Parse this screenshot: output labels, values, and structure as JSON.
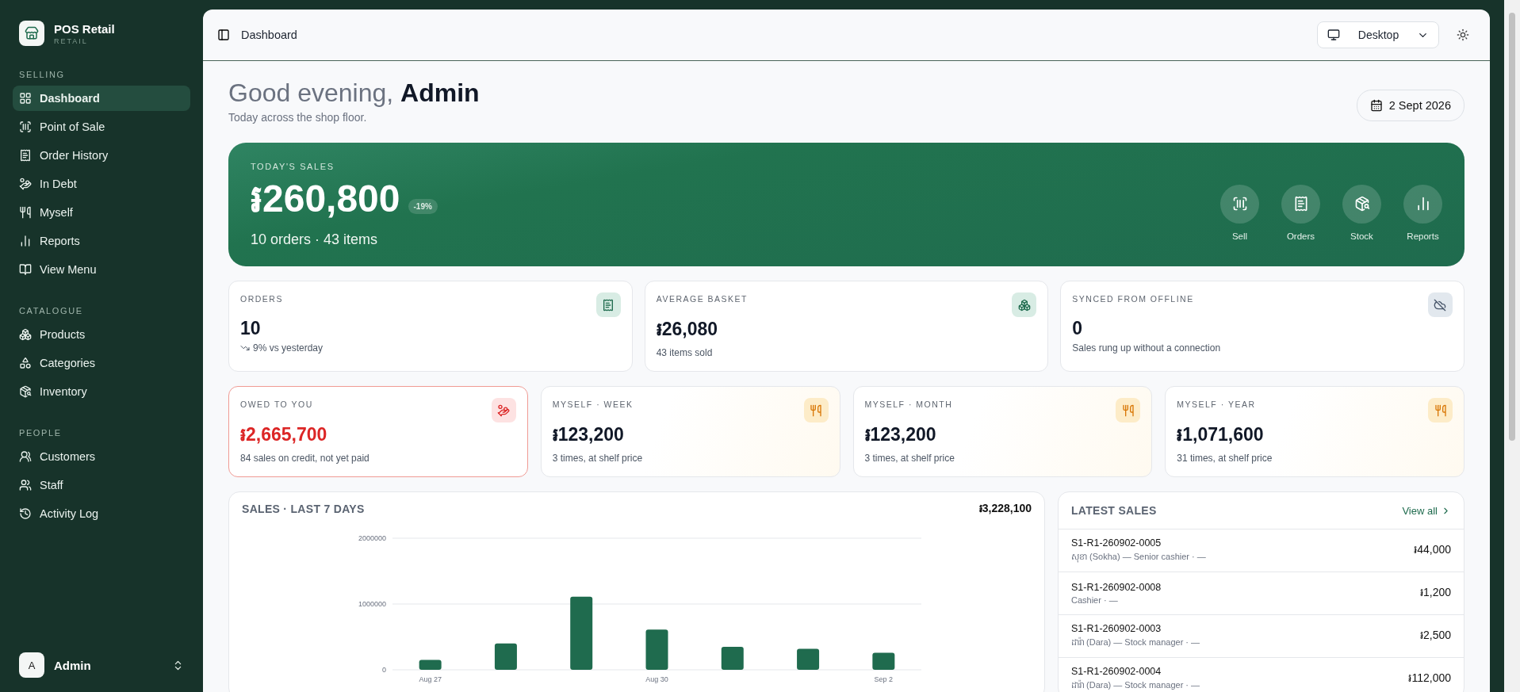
{
  "sidebar": {
    "brand": {
      "name": "POS Retail",
      "tagline": "RETAIL"
    },
    "sections": [
      {
        "title": "SELLING",
        "items": [
          {
            "label": "Dashboard",
            "selected": true
          },
          {
            "label": "Point of Sale",
            "selected": false
          },
          {
            "label": "Order History",
            "selected": false
          },
          {
            "label": "In Debt",
            "selected": false
          },
          {
            "label": "Myself",
            "selected": false
          },
          {
            "label": "Reports",
            "selected": false
          },
          {
            "label": "View Menu",
            "selected": false
          }
        ]
      },
      {
        "title": "CATALOGUE",
        "items": [
          {
            "label": "Products",
            "selected": false
          },
          {
            "label": "Categories",
            "selected": false
          },
          {
            "label": "Inventory",
            "selected": false
          }
        ]
      },
      {
        "title": "PEOPLE",
        "items": [
          {
            "label": "Customers",
            "selected": false
          },
          {
            "label": "Staff",
            "selected": false
          },
          {
            "label": "Activity Log",
            "selected": false
          }
        ]
      }
    ],
    "user": {
      "initial": "A",
      "name": "Admin"
    }
  },
  "header": {
    "breadcrumb": "Dashboard",
    "device": "Desktop"
  },
  "greeting": {
    "title": "Good evening, **Admin**",
    "subtitle": "Today across the shop floor.",
    "date": "2 Sept 2026"
  },
  "hero": {
    "label": "TODAY'S SALES",
    "amount": "៛260,800",
    "change": "-19%",
    "summary": "10 orders · 43 items",
    "actions": [
      "Sell",
      "Orders",
      "Stock",
      "Reports"
    ]
  },
  "stats": [
    {
      "kind": "orders",
      "label": "ORDERS",
      "value": "10",
      "note": "9% vs yesterday"
    },
    {
      "kind": "basket",
      "label": "AVERAGE BASKET",
      "value": "៛26,080",
      "note": "43 items sold"
    },
    {
      "kind": "offline",
      "label": "SYNCED FROM OFFLINE",
      "value": "0",
      "note": "Sales rung up without a connection"
    }
  ],
  "stats_row2": [
    {
      "kind": "debt",
      "label": "OWED TO YOU",
      "value": "៛2,665,700",
      "note": "84 sales on credit, not yet paid"
    },
    {
      "kind": "myself",
      "label": "MYSELF · WEEK",
      "value": "៛123,200",
      "note": "3 times, at shelf price"
    },
    {
      "kind": "myself",
      "label": "MYSELF · MONTH",
      "value": "៛123,200",
      "note": "3 times, at shelf price"
    },
    {
      "kind": "myself",
      "label": "MYSELF · YEAR",
      "value": "៛1,071,600",
      "note": "31 times, at shelf price"
    }
  ],
  "sales_chart": {
    "title": "SALES · LAST 7 DAYS",
    "total": "៛3,228,100",
    "chart_data": {
      "type": "bar",
      "values": [
        150000,
        400000,
        1110000,
        610000,
        350000,
        320000,
        260000
      ],
      "ylim": [
        0,
        2000000
      ],
      "yticks": [
        0,
        1000000,
        2000000
      ],
      "categories": [
        "Aug 27",
        null,
        null,
        "Aug 30",
        null,
        null,
        "Sep 2"
      ]
    }
  },
  "latest_sales": {
    "title": "LATEST SALES",
    "link": "View all",
    "rows": [
      {
        "id": "S1-R1-260902-0005",
        "meta": "សុខា (Sokha) — Senior cashier · —",
        "amount": "៛44,000"
      },
      {
        "id": "S1-R1-260902-0008",
        "meta": "Cashier · —",
        "amount": "៛1,200"
      },
      {
        "id": "S1-R1-260902-0003",
        "meta": "ដារ៉ា (Dara) — Stock manager · —",
        "amount": "៛2,500"
      },
      {
        "id": "S1-R1-260902-0004",
        "meta": "ដារ៉ា (Dara) — Stock manager · —",
        "amount": "៛112,000"
      }
    ]
  }
}
